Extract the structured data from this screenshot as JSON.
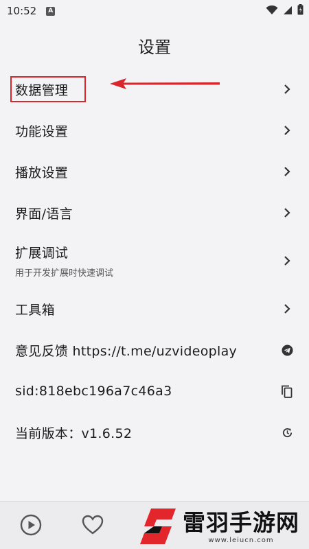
{
  "status_bar": {
    "time": "10:52",
    "app_icon_letter": "A"
  },
  "header": {
    "title": "设置"
  },
  "settings": [
    {
      "label": "数据管理",
      "action_icon": "chevron-right-icon"
    },
    {
      "label": "功能设置",
      "action_icon": "chevron-right-icon"
    },
    {
      "label": "播放设置",
      "action_icon": "chevron-right-icon"
    },
    {
      "label": "界面/语言",
      "action_icon": "chevron-right-icon"
    },
    {
      "label": "扩展调试",
      "sublabel": "用于开发扩展时快速调试",
      "action_icon": "chevron-right-icon"
    },
    {
      "label": "工具箱",
      "action_icon": "chevron-right-icon"
    },
    {
      "label": "意见反馈 https://t.me/uzvideoplay",
      "action_icon": "telegram-icon"
    },
    {
      "label": "sid:818ebc196a7c46a3",
      "action_icon": "copy-icon"
    },
    {
      "label": "当前版本：v1.6.52",
      "action_icon": "update-icon"
    }
  ],
  "bottom_nav": {
    "items": [
      "play-icon",
      "heart-icon"
    ]
  },
  "watermark": {
    "title": "雷羽手游网",
    "url": "www.leiucn.com"
  },
  "colors": {
    "annotation_red": "#d9262c",
    "background": "#f3f3f5"
  }
}
